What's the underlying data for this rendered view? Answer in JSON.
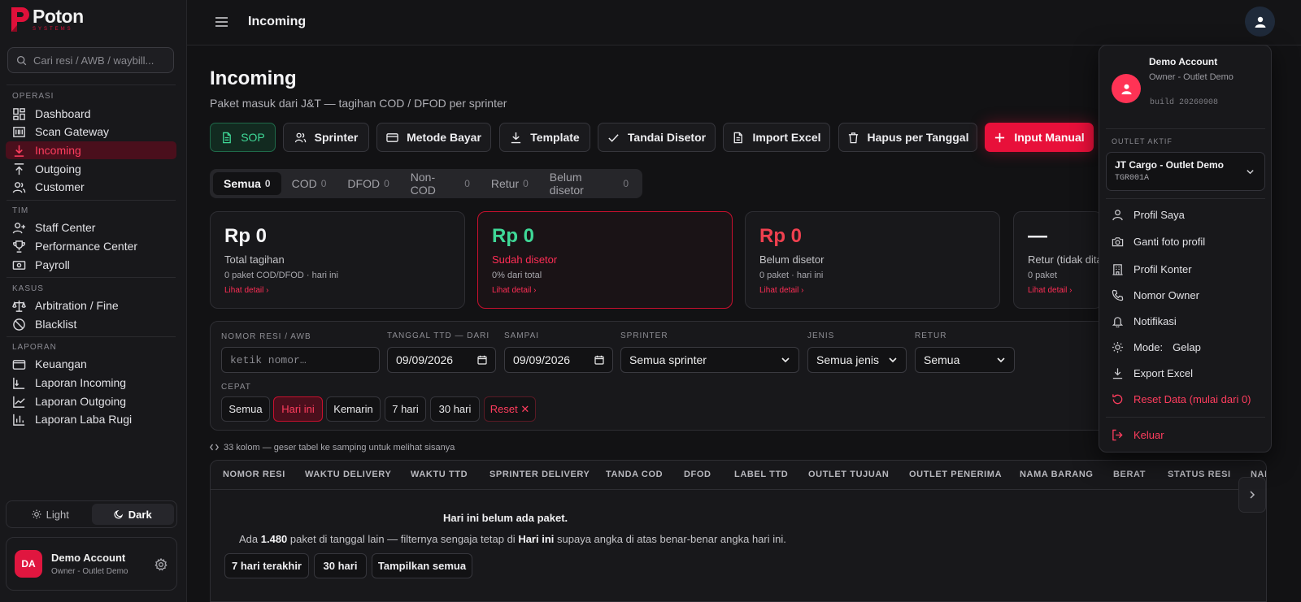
{
  "brand": {
    "name": "Poton",
    "sub": "SYSTEMS"
  },
  "search": {
    "placeholder": "Cari resi / AWB / waybill..."
  },
  "nav": {
    "sections": [
      "OPERASI",
      "TIM",
      "KASUS",
      "LAPORAN"
    ],
    "items": [
      "Dashboard",
      "Scan Gateway",
      "Incoming",
      "Outgoing",
      "Customer",
      "Staff Center",
      "Performance Center",
      "Payroll",
      "Arbitration / Fine",
      "Blacklist",
      "Keuangan",
      "Laporan Incoming",
      "Laporan Outgoing",
      "Laporan Laba Rugi"
    ],
    "active": "Incoming"
  },
  "theme": {
    "light": "Light",
    "dark": "Dark"
  },
  "user": {
    "initials": "DA",
    "name": "Demo Account",
    "role": "Owner - Outlet Demo"
  },
  "topbar": {
    "title": "Incoming"
  },
  "page": {
    "title": "Incoming",
    "subtitle": "Paket masuk dari J&T — tagihan COD / DFOD per sprinter"
  },
  "actions": [
    "SOP",
    "Sprinter",
    "Metode Bayar",
    "Template",
    "Tandai Disetor",
    "Import Excel",
    "Hapus per Tanggal",
    "Input Manual"
  ],
  "tabs": [
    {
      "label": "Semua",
      "count": "0"
    },
    {
      "label": "COD",
      "count": "0"
    },
    {
      "label": "DFOD",
      "count": "0"
    },
    {
      "label": "Non-COD",
      "count": "0"
    },
    {
      "label": "Retur",
      "count": "0"
    },
    {
      "label": "Belum disetor",
      "count": "0"
    }
  ],
  "cards": [
    {
      "value": "Rp 0",
      "label": "Total tagihan",
      "meta": "0 paket COD/DFOD · hari ini",
      "link": "Lihat detail ›"
    },
    {
      "value": "Rp 0",
      "label": "Sudah disetor",
      "meta": "0% dari total",
      "link": "Lihat detail ›"
    },
    {
      "value": "Rp 0",
      "label": "Belum disetor",
      "meta": "0 paket · hari ini",
      "link": "Lihat detail ›"
    },
    {
      "value": "—",
      "label": "Retur (tidak dita",
      "meta": "0 paket",
      "link": "Lihat detail ›"
    }
  ],
  "filters": {
    "labels": [
      "NOMOR RESI / AWB",
      "TANGGAL TTD — DARI",
      "SAMPAI",
      "SPRINTER",
      "JENIS",
      "RETUR",
      "CEPAT"
    ],
    "resi_placeholder": "ketik nomor…",
    "date_from": "09/09/2026",
    "date_to": "09/09/2026",
    "sprinter": "Semua sprinter",
    "jenis": "Semua jenis",
    "retur": "Semua",
    "quick": [
      "Semua",
      "Hari ini",
      "Kemarin",
      "7 hari",
      "30 hari",
      "Reset ✕"
    ]
  },
  "table": {
    "hint": "33 kolom — geser tabel ke samping untuk melihat sisanya",
    "columns": [
      "NOMOR RESI",
      "WAKTU DELIVERY",
      "WAKTU TTD",
      "SPRINTER DELIVERY",
      "TANDA COD",
      "DFOD",
      "LABEL TTD",
      "OUTLET TUJUAN",
      "OUTLET PENERIMA",
      "NAMA BARANG",
      "BERAT",
      "STATUS RESI",
      "NAM"
    ],
    "empty_title": "Hari ini belum ada paket.",
    "empty_text": {
      "p1": "Ada ",
      "b1": "1.480",
      "p2": " paket di tanggal lain — filternya sengaja tetap di ",
      "b2": "Hari ini",
      "p3": " supaya angka di atas benar-benar angka hari ini."
    },
    "empty_buttons": [
      "7 hari terakhir",
      "30 hari",
      "Tampilkan semua"
    ]
  },
  "menu": {
    "name": "Demo Account",
    "role": "Owner - Outlet Demo",
    "build": "build 20260908",
    "section": "OUTLET AKTIF",
    "outlet_name": "JT Cargo - Outlet Demo",
    "outlet_code": "TGR001A",
    "items": [
      "Profil Saya",
      "Ganti foto profil",
      "Profil Konter",
      "Nomor Owner",
      "Notifikasi",
      "Mode:",
      "Export Excel",
      "Reset Data (mulai dari 0)",
      "Keluar"
    ],
    "mode_value": "Gelap"
  }
}
